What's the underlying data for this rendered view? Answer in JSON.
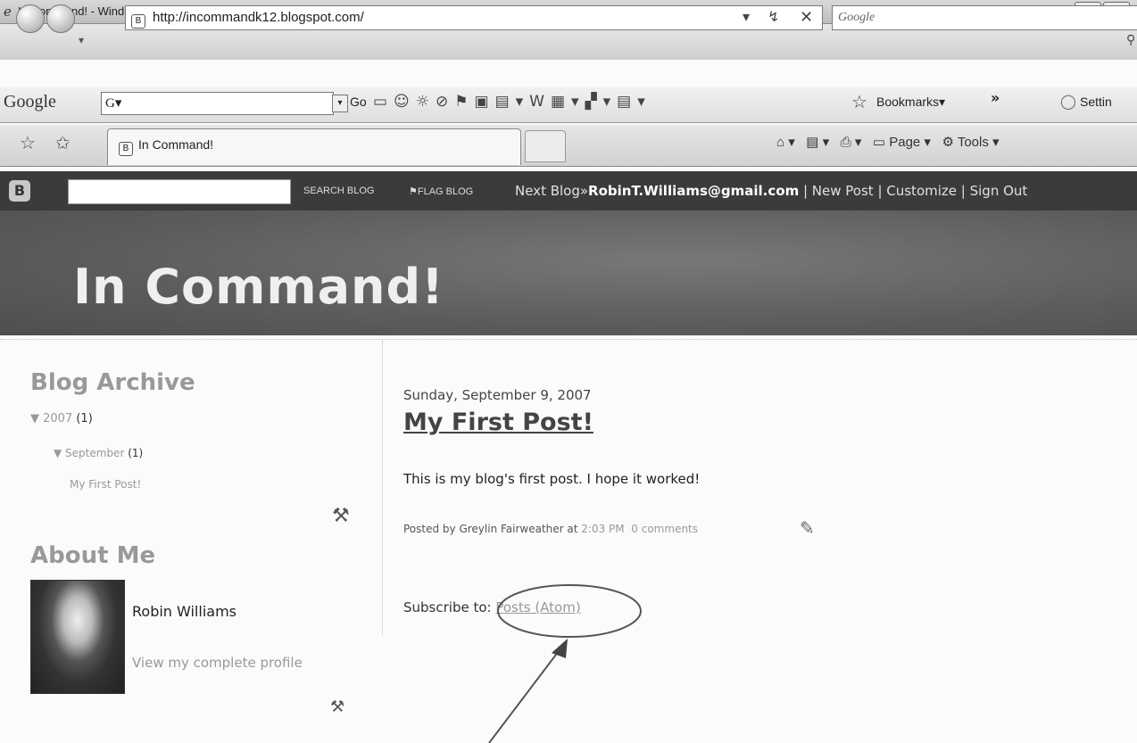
{
  "window": {
    "title": "In Command! - Windows Internet Explorer"
  },
  "address_bar": {
    "url": "http://incommandk12.blogspot.com/"
  },
  "search_box": {
    "placeholder": "Google"
  },
  "google_toolbar": {
    "logo": "Google",
    "search_value": "G▾",
    "go_label": "Go",
    "bookmarks_label": "Bookmarks▾",
    "more_label": "»",
    "settings_label": "Settin"
  },
  "tabs": {
    "active_tab": "In Command!"
  },
  "command_bar": {
    "page_label": "Page ▾",
    "tools_label": "Tools ▾"
  },
  "blogger_nav": {
    "search_blog": "SEARCH BLOG",
    "flag_blog": "FLAG BLOG",
    "next_blog": "Next Blog»",
    "email": "RobinT.Williams@gmail.com",
    "new_post": "New Post",
    "customize": "Customize",
    "sign_out": "Sign Out",
    "separator": " | "
  },
  "blog": {
    "title": "In Command!"
  },
  "sidebar": {
    "archive_heading": "Blog Archive",
    "year_label": "▼ 2007",
    "year_count": "(1)",
    "month_label": "▼ September",
    "month_count": "(1)",
    "post_link": "My First Post!",
    "about_heading": "About Me",
    "profile_name": "Robin Williams",
    "profile_link": "View my complete profile"
  },
  "post": {
    "date": "Sunday, September 9, 2007",
    "title": "My First Post!",
    "body": "This is my blog's first post. I hope it worked!",
    "posted_by": "Posted by Greylin Fairweather at",
    "time": "2:03 PM",
    "comments": "0 comments"
  },
  "subscribe": {
    "label": "Subscribe to:",
    "link": "Posts (Atom)"
  },
  "icons": {
    "page": "page-icon",
    "edit": "pencil-icon",
    "tools": "wrench-screwdriver-icon"
  }
}
